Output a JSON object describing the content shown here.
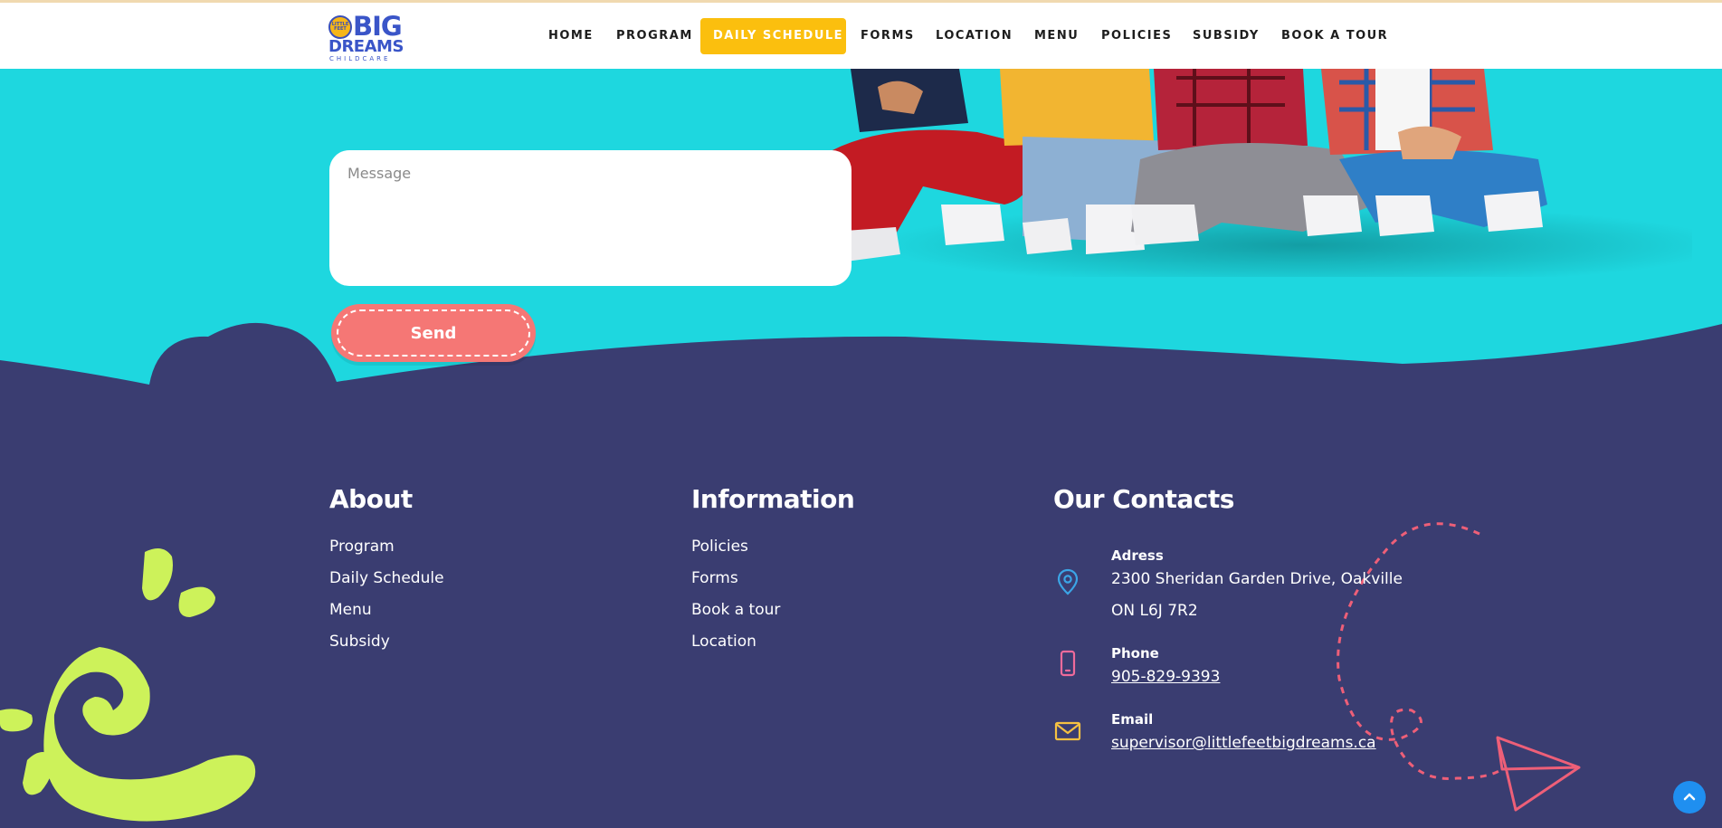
{
  "logo": {
    "badge": "LITTLE FEET",
    "big": "BIG",
    "dreams": "DREAMS",
    "childcare": "CHILDCARE"
  },
  "nav": {
    "items": [
      {
        "label": "HOME"
      },
      {
        "label": "PROGRAM"
      },
      {
        "label": "DAILY SCHEDULE",
        "active": true
      },
      {
        "label": "FORMS"
      },
      {
        "label": "LOCATION"
      },
      {
        "label": "MENU"
      },
      {
        "label": "POLICIES"
      },
      {
        "label": "SUBSIDY"
      },
      {
        "label": "BOOK A TOUR"
      }
    ]
  },
  "contact_form": {
    "message_placeholder": "Message",
    "send_label": "Send"
  },
  "footer": {
    "about": {
      "heading": "About",
      "links": [
        "Program",
        "Daily Schedule",
        "Menu",
        "Subsidy"
      ]
    },
    "information": {
      "heading": "Information",
      "links": [
        "Policies",
        "Forms",
        "Book a tour",
        "Location"
      ]
    },
    "contacts": {
      "heading": "Our Contacts",
      "address_label": "Adress",
      "address_line1": "2300 Sheridan Garden Drive, Oakville",
      "address_line2": "ON L6J 7R2",
      "phone_label": "Phone",
      "phone": "905-829-9393",
      "email_label": "Email",
      "email": "supervisor@littlefeetbigdreams.ca"
    }
  },
  "colors": {
    "accent_yellow": "#fbbf0e",
    "hero_teal": "#1ed7df",
    "footer_navy": "#3a3d71",
    "send_coral": "#f57775",
    "logo_blue": "#3a55c8",
    "swirl_green": "#cdf25a"
  },
  "icons": {
    "address": "map-pin-icon",
    "phone": "phone-icon",
    "email": "mail-icon",
    "scroll_top": "chevron-up-icon"
  }
}
